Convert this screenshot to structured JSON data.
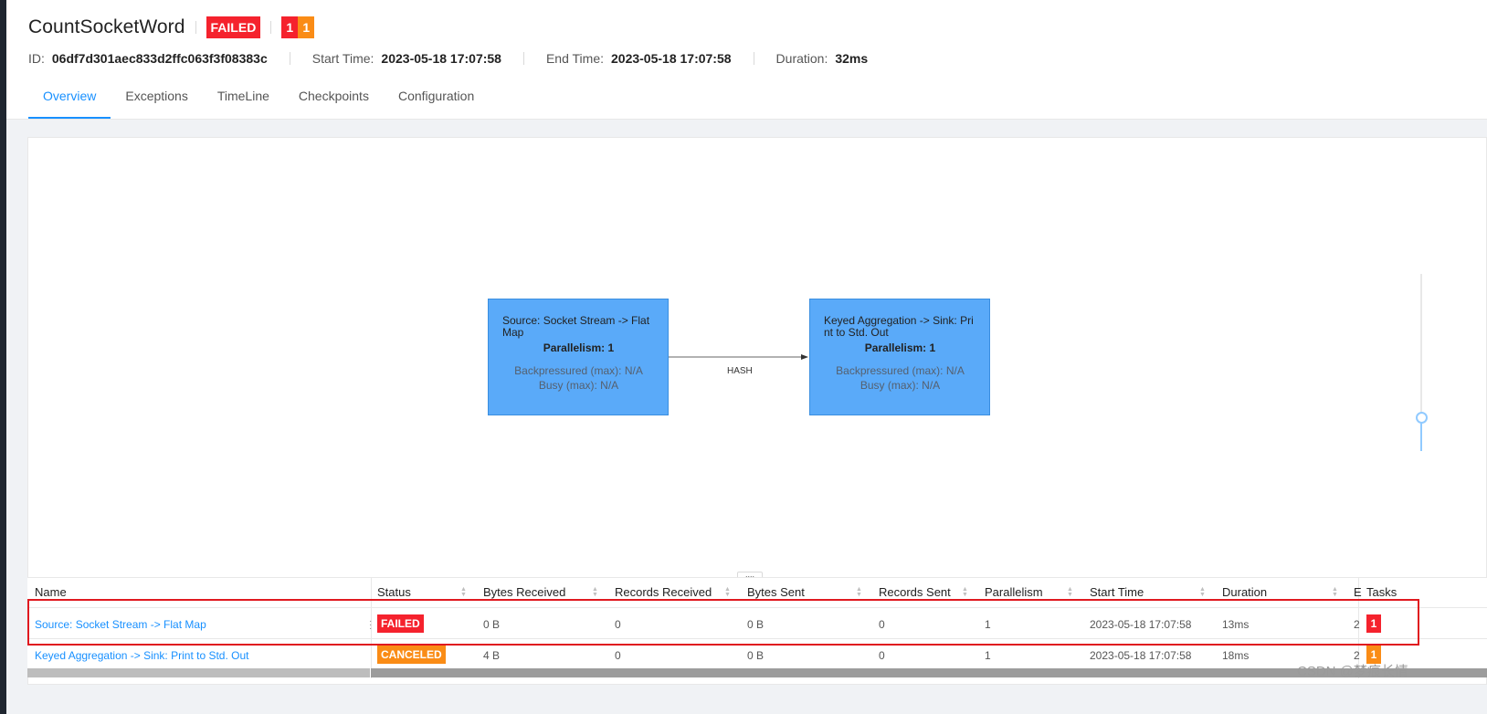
{
  "job": {
    "name": "CountSocketWord",
    "status": "FAILED",
    "task_counts": [
      "1",
      "1"
    ],
    "id_label": "ID:",
    "id": "06df7d301aec833d2ffc063f3f08383c",
    "start_label": "Start Time:",
    "start": "2023-05-18 17:07:58",
    "end_label": "End Time:",
    "end": "2023-05-18 17:07:58",
    "duration_label": "Duration:",
    "duration": "32ms"
  },
  "tabs": [
    "Overview",
    "Exceptions",
    "TimeLine",
    "Checkpoints",
    "Configuration"
  ],
  "graph": {
    "nodes": [
      {
        "name": "Source: Socket Stream -> Flat Map",
        "parallelism": "Parallelism: 1",
        "backpressure": "Backpressured (max): N/A",
        "busy": "Busy (max): N/A"
      },
      {
        "name": "Keyed Aggregation -> Sink: Print to Std. Out",
        "parallelism": "Parallelism: 1",
        "backpressure": "Backpressured (max): N/A",
        "busy": "Busy (max): N/A"
      }
    ],
    "edge_label": "HASH",
    "drag_handle": "...."
  },
  "table": {
    "headers": {
      "name": "Name",
      "status": "Status",
      "bytes_received": "Bytes Received",
      "records_received": "Records Received",
      "bytes_sent": "Bytes Sent",
      "records_sent": "Records Sent",
      "parallelism": "Parallelism",
      "start_time": "Start Time",
      "duration": "Duration",
      "end_clipped": "E",
      "tasks": "Tasks"
    },
    "rows": [
      {
        "name": "Source: Socket Stream -> Flat Map",
        "status": "FAILED",
        "bytes_received": "0 B",
        "records_received": "0",
        "bytes_sent": "0 B",
        "records_sent": "0",
        "parallelism": "1",
        "start_time": "2023-05-18 17:07:58",
        "duration": "13ms",
        "end_clipped": "2",
        "tasks": "1"
      },
      {
        "name": "Keyed Aggregation -> Sink: Print to Std. Out",
        "status": "CANCELED",
        "bytes_received": "4 B",
        "records_received": "0",
        "bytes_sent": "0 B",
        "records_sent": "0",
        "parallelism": "1",
        "start_time": "2023-05-18 17:07:58",
        "duration": "18ms",
        "end_clipped": "2",
        "tasks": "1"
      }
    ]
  },
  "watermark": "CSDN @梦痕长情",
  "colors": {
    "failed": "#f5222d",
    "canceled": "#fa8c16",
    "accent": "#1890ff",
    "node_fill": "#5aaaf9",
    "highlight_box": "#e0191f"
  }
}
